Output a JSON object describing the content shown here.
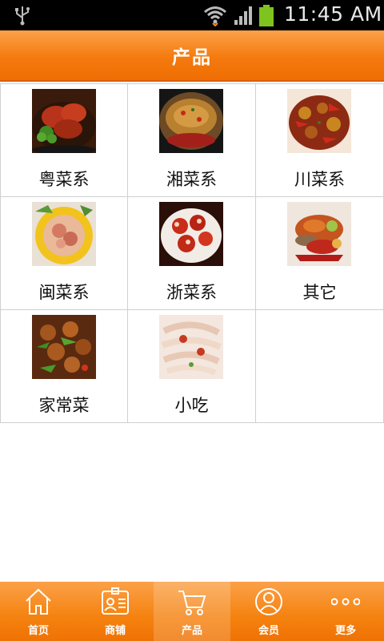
{
  "status": {
    "time": "11:45 AM"
  },
  "header": {
    "title": "产品"
  },
  "categories": [
    {
      "label": "粤菜系",
      "image": "cantonese-dish-photo"
    },
    {
      "label": "湘菜系",
      "image": "hunan-dish-photo"
    },
    {
      "label": "川菜系",
      "image": "sichuan-dish-photo"
    },
    {
      "label": "闽菜系",
      "image": "fujian-dish-photo"
    },
    {
      "label": "浙菜系",
      "image": "zhejiang-dish-photo"
    },
    {
      "label": "其它",
      "image": "other-dish-photo"
    },
    {
      "label": "家常菜",
      "image": "home-style-dish-photo"
    },
    {
      "label": "小吃",
      "image": "snack-dish-photo"
    }
  ],
  "tabs": [
    {
      "label": "首页",
      "icon": "home-icon"
    },
    {
      "label": "商铺",
      "icon": "shop-card-icon"
    },
    {
      "label": "产品",
      "icon": "cart-icon",
      "active": true
    },
    {
      "label": "会员",
      "icon": "member-icon"
    },
    {
      "label": "更多",
      "icon": "more-dots-icon"
    }
  ],
  "colors": {
    "accent": "#f47a0e",
    "status_bar": "#000000"
  }
}
